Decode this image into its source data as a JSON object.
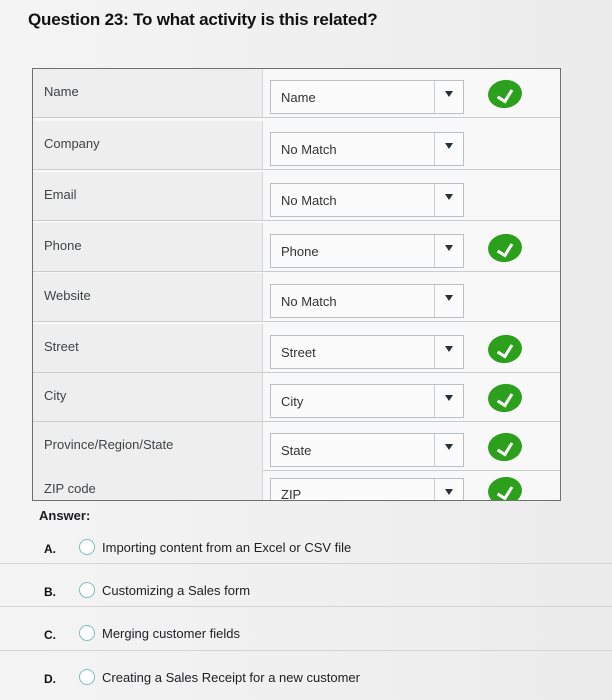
{
  "question": {
    "title": "Question 23: To what activity is this related?"
  },
  "mapping": {
    "rows": [
      {
        "field": "Name",
        "selected": "Name",
        "matched": true
      },
      {
        "field": "Company",
        "selected": "No Match",
        "matched": false
      },
      {
        "field": "Email",
        "selected": "No Match",
        "matched": false
      },
      {
        "field": "Phone",
        "selected": "Phone",
        "matched": true
      },
      {
        "field": "Website",
        "selected": "No Match",
        "matched": false
      },
      {
        "field": "Street",
        "selected": "Street",
        "matched": true
      },
      {
        "field": "City",
        "selected": "City",
        "matched": true
      },
      {
        "field": "Province/Region/State",
        "selected": "State",
        "matched": true
      },
      {
        "field": "ZIP code",
        "selected": "ZIP",
        "matched": true
      }
    ],
    "icons": {
      "dropdown": "chevron-down-icon",
      "match": "check-icon"
    },
    "colors": {
      "match": "#2ca01c",
      "radio_border": "#77c1bb"
    }
  },
  "answer": {
    "label": "Answer:",
    "options": [
      {
        "letter": "A.",
        "text": "Importing content from an Excel or CSV file"
      },
      {
        "letter": "B.",
        "text": "Customizing a Sales form"
      },
      {
        "letter": "C.",
        "text": "Merging customer fields"
      },
      {
        "letter": "D.",
        "text": "Creating a Sales Receipt for a new customer"
      }
    ]
  }
}
